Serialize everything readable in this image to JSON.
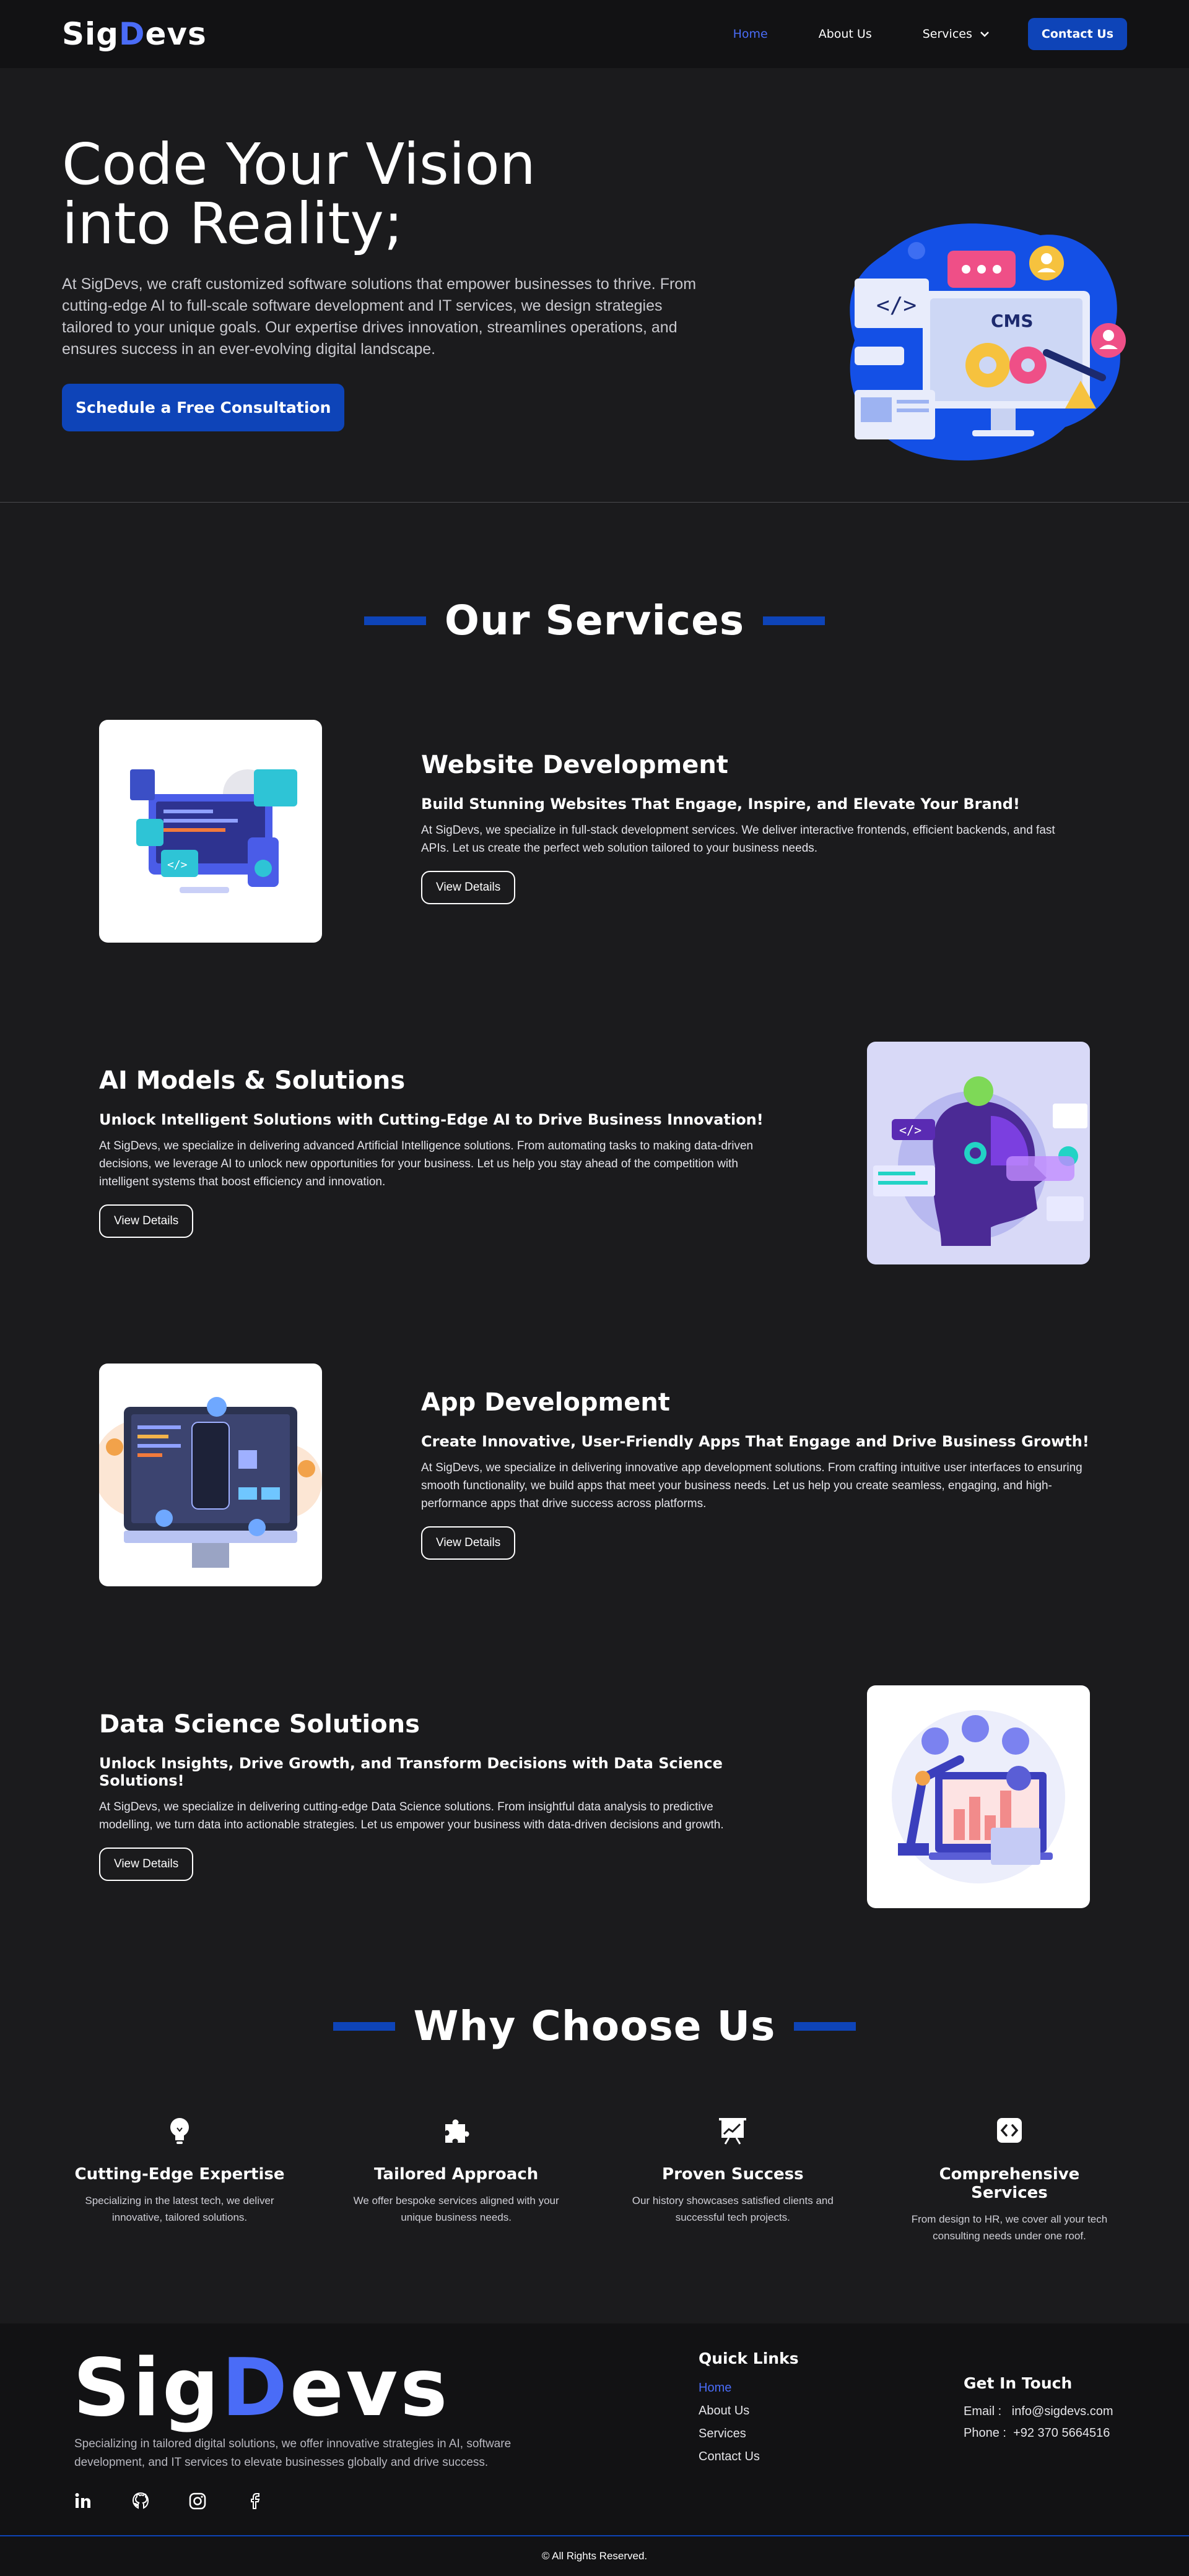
{
  "nav": {
    "logo_prefix": "Sig",
    "logo_accent": "D",
    "logo_suffix": "evs",
    "links": [
      "Home",
      "About Us",
      "Services"
    ],
    "contact_label": "Contact Us"
  },
  "hero": {
    "title_line1": "Code Your Vision",
    "title_line2": "into Reality;",
    "text": "At SigDevs, we craft customized software solutions that empower businesses to thrive. From cutting-edge AI to full-scale software development and IT services, we design strategies tailored to your unique goals. Our expertise drives innovation, streamlines operations, and ensures success in an ever-evolving digital landscape.",
    "cta": "Schedule a Free Consultation",
    "art_label": "CMS"
  },
  "services": {
    "heading": "Our Services",
    "items": [
      {
        "title": "Website Development",
        "subtitle": "Build Stunning Websites That Engage, Inspire, and Elevate Your Brand!",
        "text": "At SigDevs, we specialize in full-stack development services. We deliver interactive frontends, efficient backends, and fast APIs. Let us create the perfect web solution tailored to your business needs.",
        "button": "View Details"
      },
      {
        "title": "AI Models & Solutions",
        "subtitle": "Unlock Intelligent Solutions with Cutting-Edge AI to Drive Business Innovation!",
        "text": "At SigDevs, we specialize in delivering advanced Artificial Intelligence solutions. From automating tasks to making data-driven decisions, we leverage AI to unlock new opportunities for your business. Let us help you stay ahead of the competition with intelligent systems that boost efficiency and innovation.",
        "button": "View Details"
      },
      {
        "title": "App Development",
        "subtitle": "Create Innovative, User-Friendly Apps That Engage and Drive Business Growth!",
        "text": "At SigDevs, we specialize in delivering innovative app development solutions. From crafting intuitive user interfaces to ensuring smooth functionality, we build apps that meet your business needs. Let us help you create seamless, engaging, and high-performance apps that drive success across platforms.",
        "button": "View Details"
      },
      {
        "title": "Data Science Solutions",
        "subtitle": "Unlock Insights, Drive Growth, and Transform Decisions with Data Science Solutions!",
        "text": "At SigDevs, we specialize in delivering cutting-edge Data Science solutions. From insightful data analysis to predictive modelling, we turn data into actionable strategies. Let us empower your business with data-driven decisions and growth.",
        "button": "View Details"
      }
    ]
  },
  "why": {
    "heading": "Why Choose Us",
    "items": [
      {
        "icon": "lightbulb-icon",
        "title": "Cutting-Edge Expertise",
        "text": "Specializing in the latest tech, we deliver innovative, tailored solutions."
      },
      {
        "icon": "puzzle-icon",
        "title": "Tailored Approach",
        "text": "We offer bespoke services aligned with your unique business needs."
      },
      {
        "icon": "chart-board-icon",
        "title": "Proven Success",
        "text": "Our history showcases satisfied clients and successful tech projects."
      },
      {
        "icon": "code-icon",
        "title": "Comprehensive Services",
        "text": "From design to HR, we cover all your tech consulting needs under one roof."
      }
    ]
  },
  "footer": {
    "description": "Specializing in tailored digital solutions, we offer innovative strategies in AI, software development, and IT services to elevate businesses globally and drive success.",
    "social": [
      "linkedin-icon",
      "github-icon",
      "instagram-icon",
      "facebook-icon"
    ],
    "quick_links_title": "Quick Links",
    "quick_links": [
      "Home",
      "About Us",
      "Services",
      "Contact Us"
    ],
    "contact_title": "Get In Touch",
    "email_label": "Email :",
    "email": "info@sigdevs.com",
    "phone_label": "Phone :",
    "phone": "+92 370 5664516",
    "copyright": "© All Rights Reserved."
  },
  "colors": {
    "background": "#1b1b1d",
    "nav_bg": "#121214",
    "accent": "#0e44b8",
    "link_active": "#4a6cf7"
  }
}
